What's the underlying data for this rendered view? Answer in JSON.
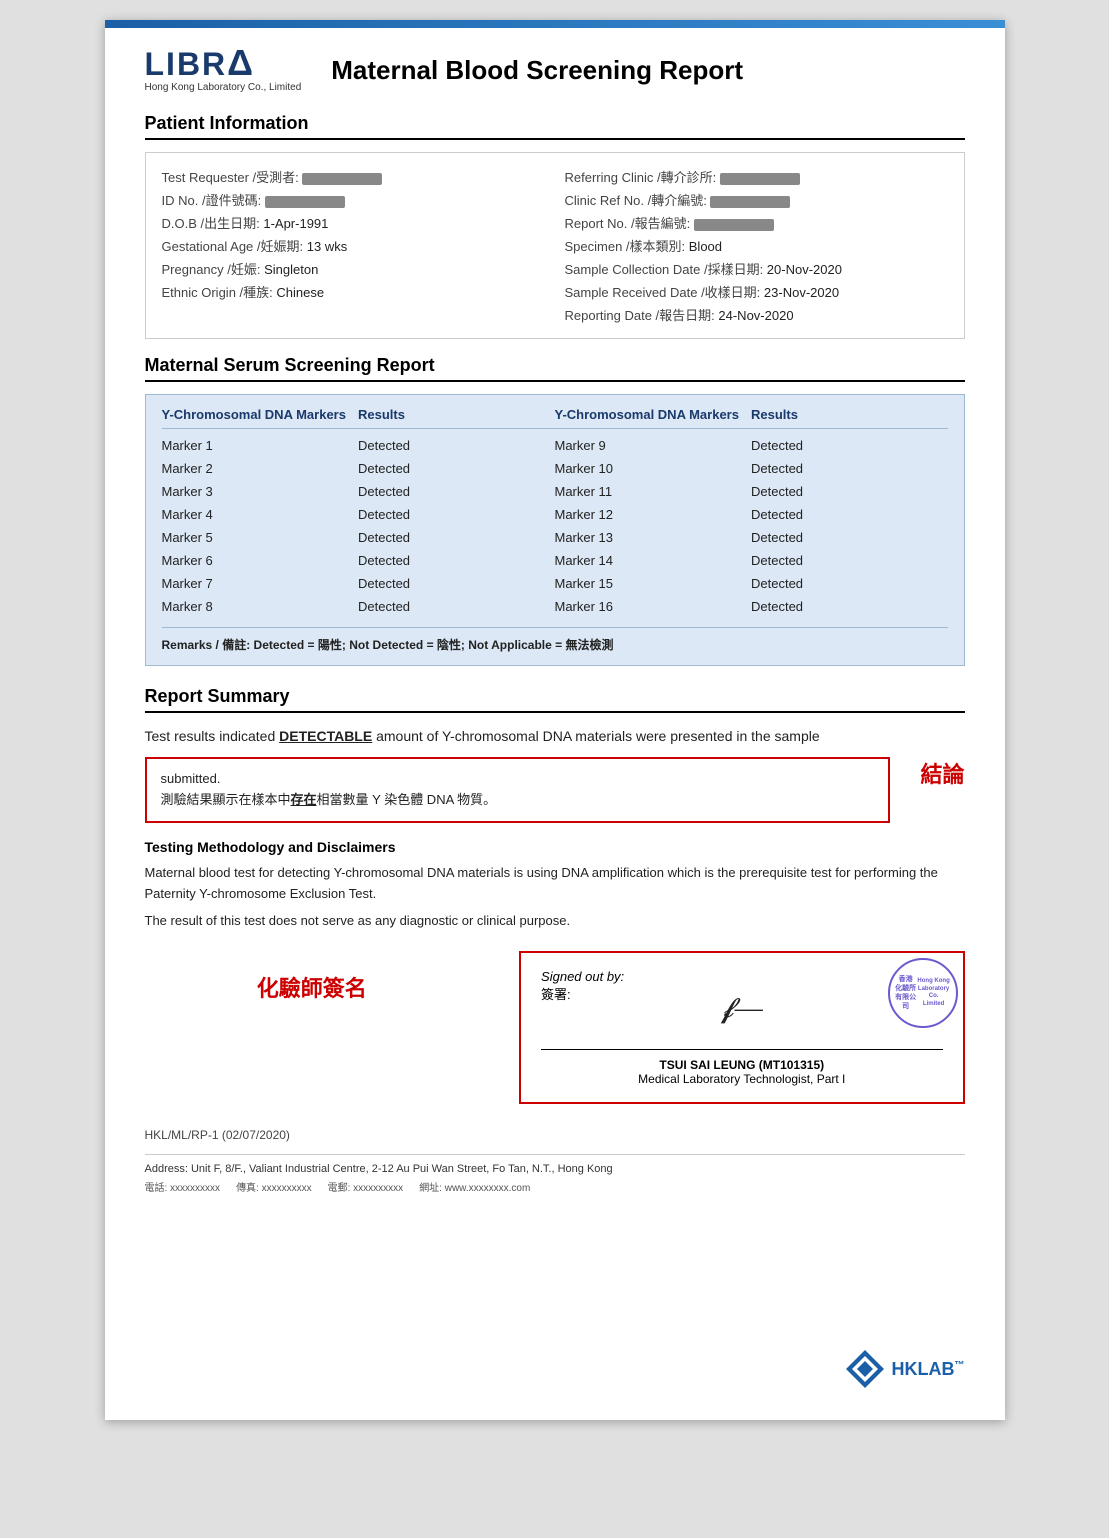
{
  "page": {
    "top_bar_color": "#1a5fa8",
    "logo": {
      "name": "LIBRA",
      "subtitle": "Hong Kong Laboratory Co., Limited"
    },
    "report_title": "Maternal Blood Screening Report"
  },
  "patient_info": {
    "section_label": "Patient Information",
    "fields_left": [
      {
        "label": "Test Requester /受測者:",
        "value": ""
      },
      {
        "label": "ID No. /證件號碼:",
        "value": ""
      },
      {
        "label": "D.O.B /出生日期:",
        "value": "1-Apr-1991"
      },
      {
        "label": "Gestational Age /妊娠期:",
        "value": "13 wks"
      },
      {
        "label": "Pregnancy /妊娠:",
        "value": "Singleton"
      },
      {
        "label": "Ethnic Origin /種族:",
        "value": "Chinese"
      }
    ],
    "fields_right": [
      {
        "label": "Referring Clinic /轉介診所:",
        "value": ""
      },
      {
        "label": "Clinic Ref No. /轉介編號:",
        "value": ""
      },
      {
        "label": "Report No. /報告編號:",
        "value": ""
      },
      {
        "label": "Specimen /樣本類別:",
        "value": "Blood"
      },
      {
        "label": "Sample Collection Date /採樣日期:",
        "value": "20-Nov-2020"
      },
      {
        "label": "Sample Received Date /收樣日期:",
        "value": "23-Nov-2020"
      },
      {
        "label": "Reporting Date /報告日期:",
        "value": "24-Nov-2020"
      }
    ]
  },
  "serum_screening": {
    "section_label": "Maternal Serum Screening Report",
    "col1_header": "Y-Chromosomal DNA Markers",
    "col2_header": "Results",
    "col3_header": "Y-Chromosomal DNA Markers",
    "col4_header": "Results",
    "markers_left": [
      {
        "name": "Marker 1",
        "result": "Detected"
      },
      {
        "name": "Marker 2",
        "result": "Detected"
      },
      {
        "name": "Marker 3",
        "result": "Detected"
      },
      {
        "name": "Marker 4",
        "result": "Detected"
      },
      {
        "name": "Marker 5",
        "result": "Detected"
      },
      {
        "name": "Marker 6",
        "result": "Detected"
      },
      {
        "name": "Marker 7",
        "result": "Detected"
      },
      {
        "name": "Marker 8",
        "result": "Detected"
      }
    ],
    "markers_right": [
      {
        "name": "Marker 9",
        "result": "Detected"
      },
      {
        "name": "Marker 10",
        "result": "Detected"
      },
      {
        "name": "Marker 11",
        "result": "Detected"
      },
      {
        "name": "Marker 12",
        "result": "Detected"
      },
      {
        "name": "Marker 13",
        "result": "Detected"
      },
      {
        "name": "Marker 14",
        "result": "Detected"
      },
      {
        "name": "Marker 15",
        "result": "Detected"
      },
      {
        "name": "Marker 16",
        "result": "Detected"
      }
    ],
    "remarks": "Remarks / 備註: Detected = 陽性; Not Detected = 陰性; Not Applicable = 無法檢測"
  },
  "report_summary": {
    "section_label": "Report Summary",
    "summary_line1": "Test results indicated ",
    "summary_highlight": "DETECTABLE",
    "summary_line2": " amount of Y-chromosomal DNA materials were presented in the sample",
    "summary_line3": "submitted.",
    "summary_chinese": "測驗結果顯示在樣本中",
    "summary_chinese_bold": "存在",
    "summary_chinese2": "相當數量 Y 染色體 DNA 物質。",
    "conclusion_label": "結論"
  },
  "methodology": {
    "title": "Testing Methodology and Disclaimers",
    "text1": "Maternal blood test for detecting Y-chromosomal DNA materials is using DNA amplification which is the prerequisite test for performing the Paternity Y-chromosome Exclusion Test.",
    "text2": "The result of this test does not serve as any diagnostic or clinical purpose."
  },
  "signature": {
    "chemist_label": "化驗師簽名",
    "signed_out_label": "Signed out by:",
    "signed_out_chinese": "簽署:",
    "signatory_name": "TSUI SAI LEUNG (MT101315)",
    "signatory_title": "Medical Laboratory Technologist, Part I",
    "stamp_text": "香港\n化驗所\n有限公司\nHong Kong\nLaboratory Co.\nLimited"
  },
  "footer": {
    "ref": "HKL/ML/RP-1 (02/07/2020)",
    "address": "Address: Unit F, 8/F., Valiant Industrial Centre, 2-12 Au Pui Wan Street, Fo Tan, N.T., Hong Kong",
    "contacts": [
      "電話: xxxxxxxxxx",
      "傳真: xxxxxxxxxx",
      "電郵: xxxxxxxxxx",
      "網址: www.xxxxxxxx.com"
    ]
  }
}
